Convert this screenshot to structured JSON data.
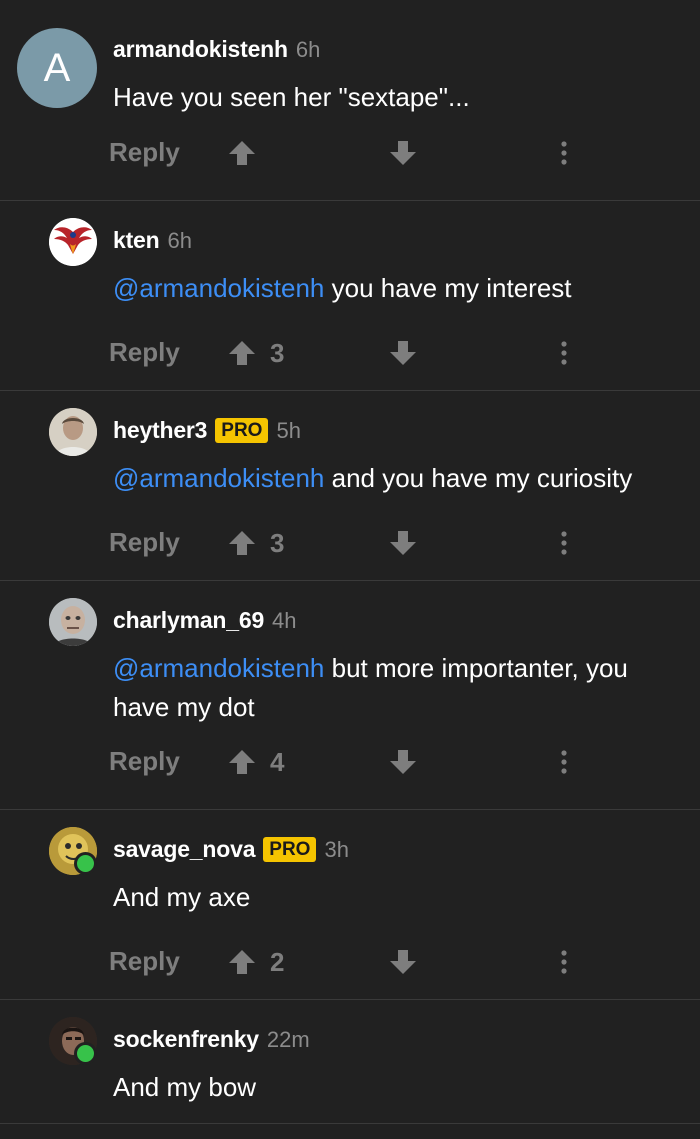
{
  "actions": {
    "reply_label": "Reply"
  },
  "colors": {
    "background": "#212121",
    "mention": "#3d8ef5",
    "pro_badge": "#f5c400",
    "online": "#37c24a",
    "muted": "#7e7e7e"
  },
  "comments": [
    {
      "username": "armandokistenh",
      "time": "6h",
      "avatar_letter": "A",
      "text": "Have you seen her \"sextape\"...",
      "upvotes": ""
    },
    {
      "username": "kten",
      "time": "6h",
      "mention": "@armandokistenh",
      "text": " you have my interest",
      "upvotes": "3"
    },
    {
      "username": "heyther3",
      "badge": "PRO",
      "time": "5h",
      "mention": "@armandokistenh",
      "text": " and you have my curiosity",
      "upvotes": "3"
    },
    {
      "username": "charlyman_69",
      "time": "4h",
      "mention": "@armandokistenh",
      "text": " but more importanter, you have my dot",
      "upvotes": "4"
    },
    {
      "username": "savage_nova",
      "badge": "PRO",
      "time": "3h",
      "text": "And my axe",
      "upvotes": "2"
    },
    {
      "username": "sockenfrenky",
      "time": "22m",
      "text": "And my bow"
    }
  ]
}
